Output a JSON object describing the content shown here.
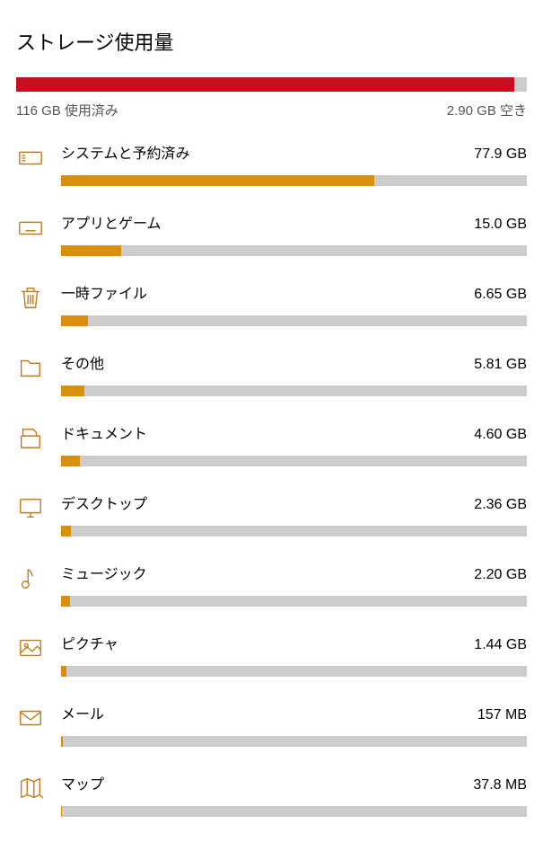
{
  "title": "ストレージ使用量",
  "total": {
    "used_label": "116 GB 使用済み",
    "free_label": "2.90 GB 空き",
    "used_gb": 116,
    "free_gb": 2.9,
    "capacity_gb": 118.9,
    "fill_pct": 97.56
  },
  "categories": [
    {
      "id": "system",
      "name": "システムと予約済み",
      "size_label": "77.9 GB",
      "size_gb": 77.9,
      "fill_pct": 67.16,
      "icon": "system-icon"
    },
    {
      "id": "apps",
      "name": "アプリとゲーム",
      "size_label": "15.0 GB",
      "size_gb": 15.0,
      "fill_pct": 12.93,
      "icon": "keyboard-icon"
    },
    {
      "id": "temp",
      "name": "一時ファイル",
      "size_label": "6.65 GB",
      "size_gb": 6.65,
      "fill_pct": 5.73,
      "icon": "trash-icon"
    },
    {
      "id": "other",
      "name": "その他",
      "size_label": "5.81 GB",
      "size_gb": 5.81,
      "fill_pct": 5.01,
      "icon": "folder-icon"
    },
    {
      "id": "docs",
      "name": "ドキュメント",
      "size_label": "4.60 GB",
      "size_gb": 4.6,
      "fill_pct": 3.97,
      "icon": "document-icon"
    },
    {
      "id": "desktop",
      "name": "デスクトップ",
      "size_label": "2.36 GB",
      "size_gb": 2.36,
      "fill_pct": 2.03,
      "icon": "desktop-icon"
    },
    {
      "id": "music",
      "name": "ミュージック",
      "size_label": "2.20 GB",
      "size_gb": 2.2,
      "fill_pct": 1.9,
      "icon": "music-icon"
    },
    {
      "id": "pictures",
      "name": "ピクチャ",
      "size_label": "1.44 GB",
      "size_gb": 1.44,
      "fill_pct": 1.24,
      "icon": "image-icon"
    },
    {
      "id": "mail",
      "name": "メール",
      "size_label": "157 MB",
      "size_gb": 0.153,
      "fill_pct": 0.4,
      "icon": "mail-icon"
    },
    {
      "id": "maps",
      "name": "マップ",
      "size_label": "37.8 MB",
      "size_gb": 0.037,
      "fill_pct": 0.25,
      "icon": "map-icon"
    }
  ],
  "colors": {
    "used_bar": "#c50f1f",
    "cat_bar": "#da8f0a",
    "empty_bar": "#cccccc",
    "icon": "#c57a1f"
  },
  "chart_data": {
    "type": "bar",
    "title": "ストレージ使用量",
    "xlabel": "",
    "ylabel": "GB",
    "ylim": [
      0,
      118.9
    ],
    "categories": [
      "システムと予約済み",
      "アプリとゲーム",
      "一時ファイル",
      "その他",
      "ドキュメント",
      "デスクトップ",
      "ミュージック",
      "ピクチャ",
      "メール",
      "マップ"
    ],
    "values": [
      77.9,
      15.0,
      6.65,
      5.81,
      4.6,
      2.36,
      2.2,
      1.44,
      0.153,
      0.037
    ]
  }
}
